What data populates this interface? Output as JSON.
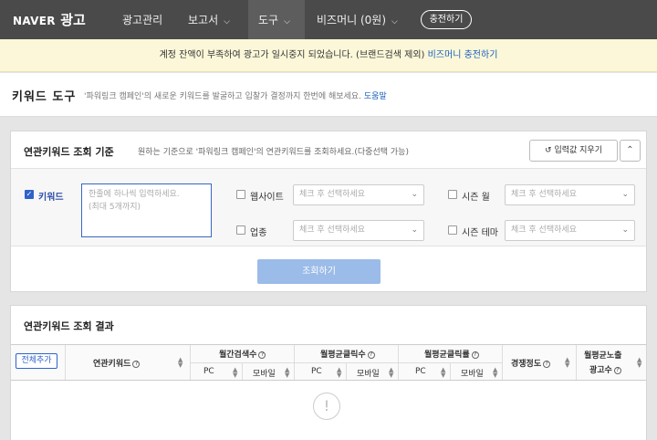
{
  "nav": {
    "logo_naver": "NAVER",
    "logo_ad": "광고",
    "items": [
      {
        "label": "광고관리",
        "chevron": false
      },
      {
        "label": "보고서",
        "chevron": true
      },
      {
        "label": "도구",
        "chevron": true,
        "active": true
      },
      {
        "label": "비즈머니 (0원)",
        "chevron": true
      }
    ],
    "charge_button": "충전하기"
  },
  "notice": {
    "text": "계정 잔액이 부족하여 광고가 일시중지 되었습니다. (브랜드검색 제외) ",
    "link": "비즈머니 충전하기"
  },
  "page": {
    "title": "키워드 도구",
    "description": "'파워링크 캠페인'의 새로운 키워드를 발굴하고 입찰가 결정까지 한번에 해보세요. ",
    "help_link": "도움말"
  },
  "search_panel": {
    "title": "연관키워드 조회 기준",
    "description": "원하는 기준으로 '파워링크 캠페인'의 연관키워드를 조회하세요.(다중선택 가능)",
    "reset_button": "입력값 지우기",
    "collapse_icon": "chevron-up-icon",
    "keyword": {
      "label": "키워드",
      "checked": true,
      "placeholder_line1": "한줄에 하나씩 입력하세요.",
      "placeholder_line2": "(최대 5개까지)"
    },
    "website": {
      "label": "웹사이트",
      "placeholder": "체크 후 선택하세요"
    },
    "industry": {
      "label": "업종",
      "placeholder": "체크 후 선택하세요"
    },
    "season_month": {
      "label": "시즌 월",
      "placeholder": "체크 후 선택하세요"
    },
    "season_theme": {
      "label": "시즌 테마",
      "placeholder": "체크 후 선택하세요"
    },
    "search_button": "조회하기"
  },
  "results": {
    "title": "연관키워드 조회 결과",
    "add_all_button": "전체추가",
    "columns": {
      "keyword": "연관키워드",
      "monthly_search": "월간검색수",
      "avg_clicks": "월평균클릭수",
      "avg_ctr": "월평균클릭률",
      "competition": "경쟁정도",
      "avg_ad_exposure_line1": "월평균노출",
      "avg_ad_exposure_line2": "광고수",
      "pc": "PC",
      "mobile": "모바일"
    },
    "empty_icon": "exclamation-circle-icon"
  },
  "colors": {
    "nav_bg": "#4a4a4a",
    "notice_bg": "#fbf7d8",
    "accent": "#2f63c9",
    "link": "#1a5fbf",
    "search_button": "#9bbbe8"
  }
}
